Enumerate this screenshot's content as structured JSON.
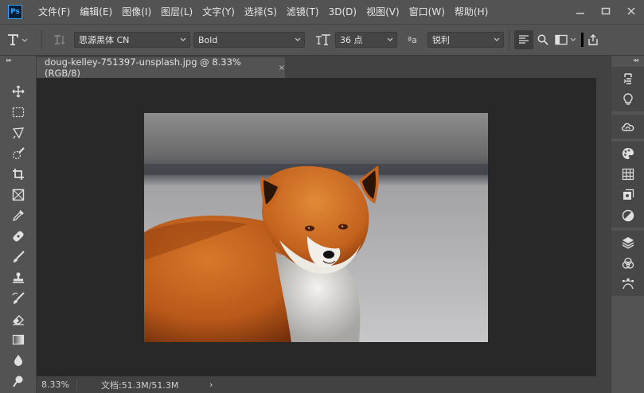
{
  "app": {
    "logo_text": "Ps"
  },
  "menu": {
    "items": [
      "文件(F)",
      "编辑(E)",
      "图像(I)",
      "图层(L)",
      "文字(Y)",
      "选择(S)",
      "滤镜(T)",
      "3D(D)",
      "视图(V)",
      "窗口(W)",
      "帮助(H)"
    ]
  },
  "options": {
    "font_family": "思源黑体 CN",
    "font_style": "Bold",
    "font_size": "36 点",
    "antialias_icon_text": "ªa",
    "antialias": "锐利"
  },
  "document": {
    "tab_title": "doug-kelley-751397-unsplash.jpg @ 8.33%(RGB/8)",
    "close_symbol": "×"
  },
  "status": {
    "zoom": "8.33%",
    "doc_size": "文档:51.3M/51.3M",
    "arrow": "›"
  },
  "colors": {
    "ui_background": "#535353",
    "canvas_background": "#282828",
    "tab_bar": "#424242",
    "photoshop_blue": "#31a8ff"
  },
  "icons": {
    "left_tools": [
      "move-tool-icon",
      "marquee-tool-icon",
      "lasso-tool-icon",
      "quick-selection-tool-icon",
      "crop-tool-icon",
      "frame-tool-icon",
      "eyedropper-tool-icon",
      "healing-brush-tool-icon",
      "brush-tool-icon",
      "clone-stamp-tool-icon",
      "history-brush-tool-icon",
      "eraser-tool-icon",
      "gradient-tool-icon",
      "blur-tool-icon",
      "dodge-tool-icon"
    ],
    "right_panel": [
      "history-panel-icon",
      "learn-panel-icon",
      "libraries-panel-icon",
      "color-panel-icon",
      "swatches-panel-icon",
      "properties-panel-icon",
      "adjustments-panel-icon",
      "layers-panel-icon",
      "channels-panel-icon",
      "paths-panel-icon"
    ]
  }
}
